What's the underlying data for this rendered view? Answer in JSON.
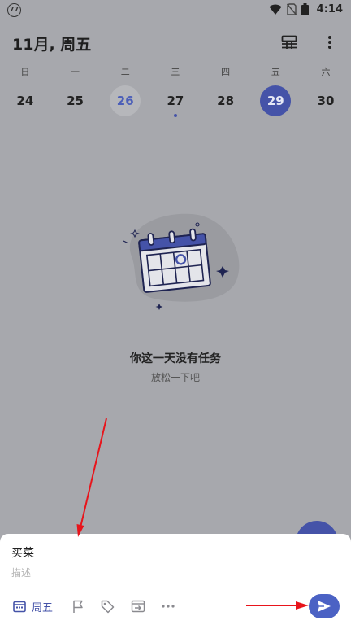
{
  "status_bar": {
    "app_badge": "77",
    "time": "4:14",
    "icons": [
      "wifi-icon",
      "no-sim-icon",
      "battery-icon"
    ]
  },
  "header": {
    "title": "11月, 周五",
    "actions": [
      "view-toggle-icon",
      "more-vert-icon"
    ]
  },
  "week": {
    "weekdays": [
      "日",
      "一",
      "二",
      "三",
      "四",
      "五",
      "六"
    ],
    "dates": [
      {
        "label": "24",
        "state": "normal",
        "has_task": false
      },
      {
        "label": "25",
        "state": "normal",
        "has_task": false
      },
      {
        "label": "26",
        "state": "today",
        "has_task": false
      },
      {
        "label": "27",
        "state": "normal",
        "has_task": true
      },
      {
        "label": "28",
        "state": "normal",
        "has_task": false
      },
      {
        "label": "29",
        "state": "selected",
        "has_task": false
      },
      {
        "label": "30",
        "state": "normal",
        "has_task": false
      }
    ]
  },
  "empty_state": {
    "illustration": "calendar-illustration",
    "title": "你这一天没有任务",
    "subtitle": "放松一下吧"
  },
  "composer": {
    "task_value": "买菜",
    "description_placeholder": "描述",
    "date_label": "周五",
    "toolbar_icons": [
      "calendar-icon",
      "flag-icon",
      "tag-icon",
      "move-to-list-icon",
      "more-horiz-icon"
    ],
    "send_icon": "send-icon"
  },
  "colors": {
    "overlay_background": "#a7a8ad",
    "accent": "#4553a8",
    "send_button": "#4b62c4",
    "annotation_arrow": "#e8141b"
  }
}
